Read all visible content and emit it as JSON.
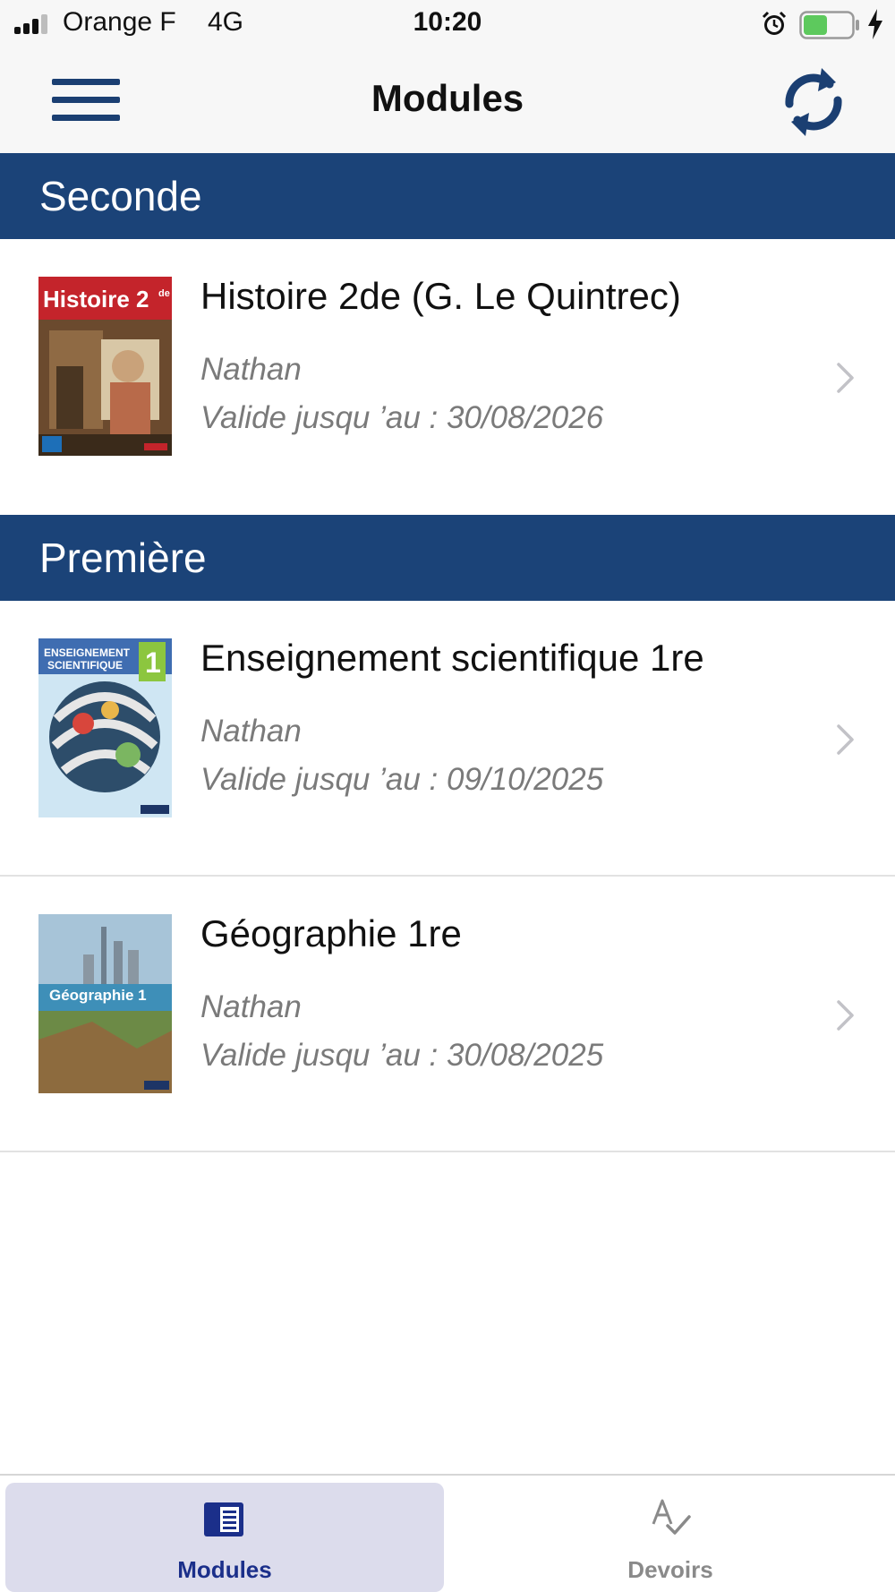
{
  "status_bar": {
    "carrier": "Orange F",
    "network": "4G",
    "time": "10:20",
    "battery_color": "#5dc95d"
  },
  "nav": {
    "title": "Modules",
    "menu_icon": "hamburger-icon",
    "refresh_icon": "refresh-icon",
    "accent_color": "#1b3f72"
  },
  "sections": [
    {
      "header": "Seconde",
      "modules": [
        {
          "cover_text": "Histoire 2de",
          "title": "Histoire 2de (G. Le Quintrec)",
          "publisher": "Nathan",
          "validity": "Valide jusqu ’au : 30/08/2026"
        }
      ]
    },
    {
      "header": "Première",
      "modules": [
        {
          "cover_text": "ENSEIGNEMENT SCIENTIFIQUE 1",
          "title": "Enseignement scientifique 1re",
          "publisher": "Nathan",
          "validity": "Valide jusqu ’au : 09/10/2025"
        },
        {
          "cover_text": "Géographie 1re",
          "title": "Géographie 1re",
          "publisher": "Nathan",
          "validity": "Valide jusqu ’au : 30/08/2025"
        }
      ]
    }
  ],
  "tab_bar": {
    "tabs": [
      {
        "label": "Modules",
        "icon": "book-icon",
        "active": true,
        "color": "#1b2f8a"
      },
      {
        "label": "Devoirs",
        "icon": "spellcheck-icon",
        "active": false,
        "color": "#8a8a8a"
      }
    ]
  }
}
